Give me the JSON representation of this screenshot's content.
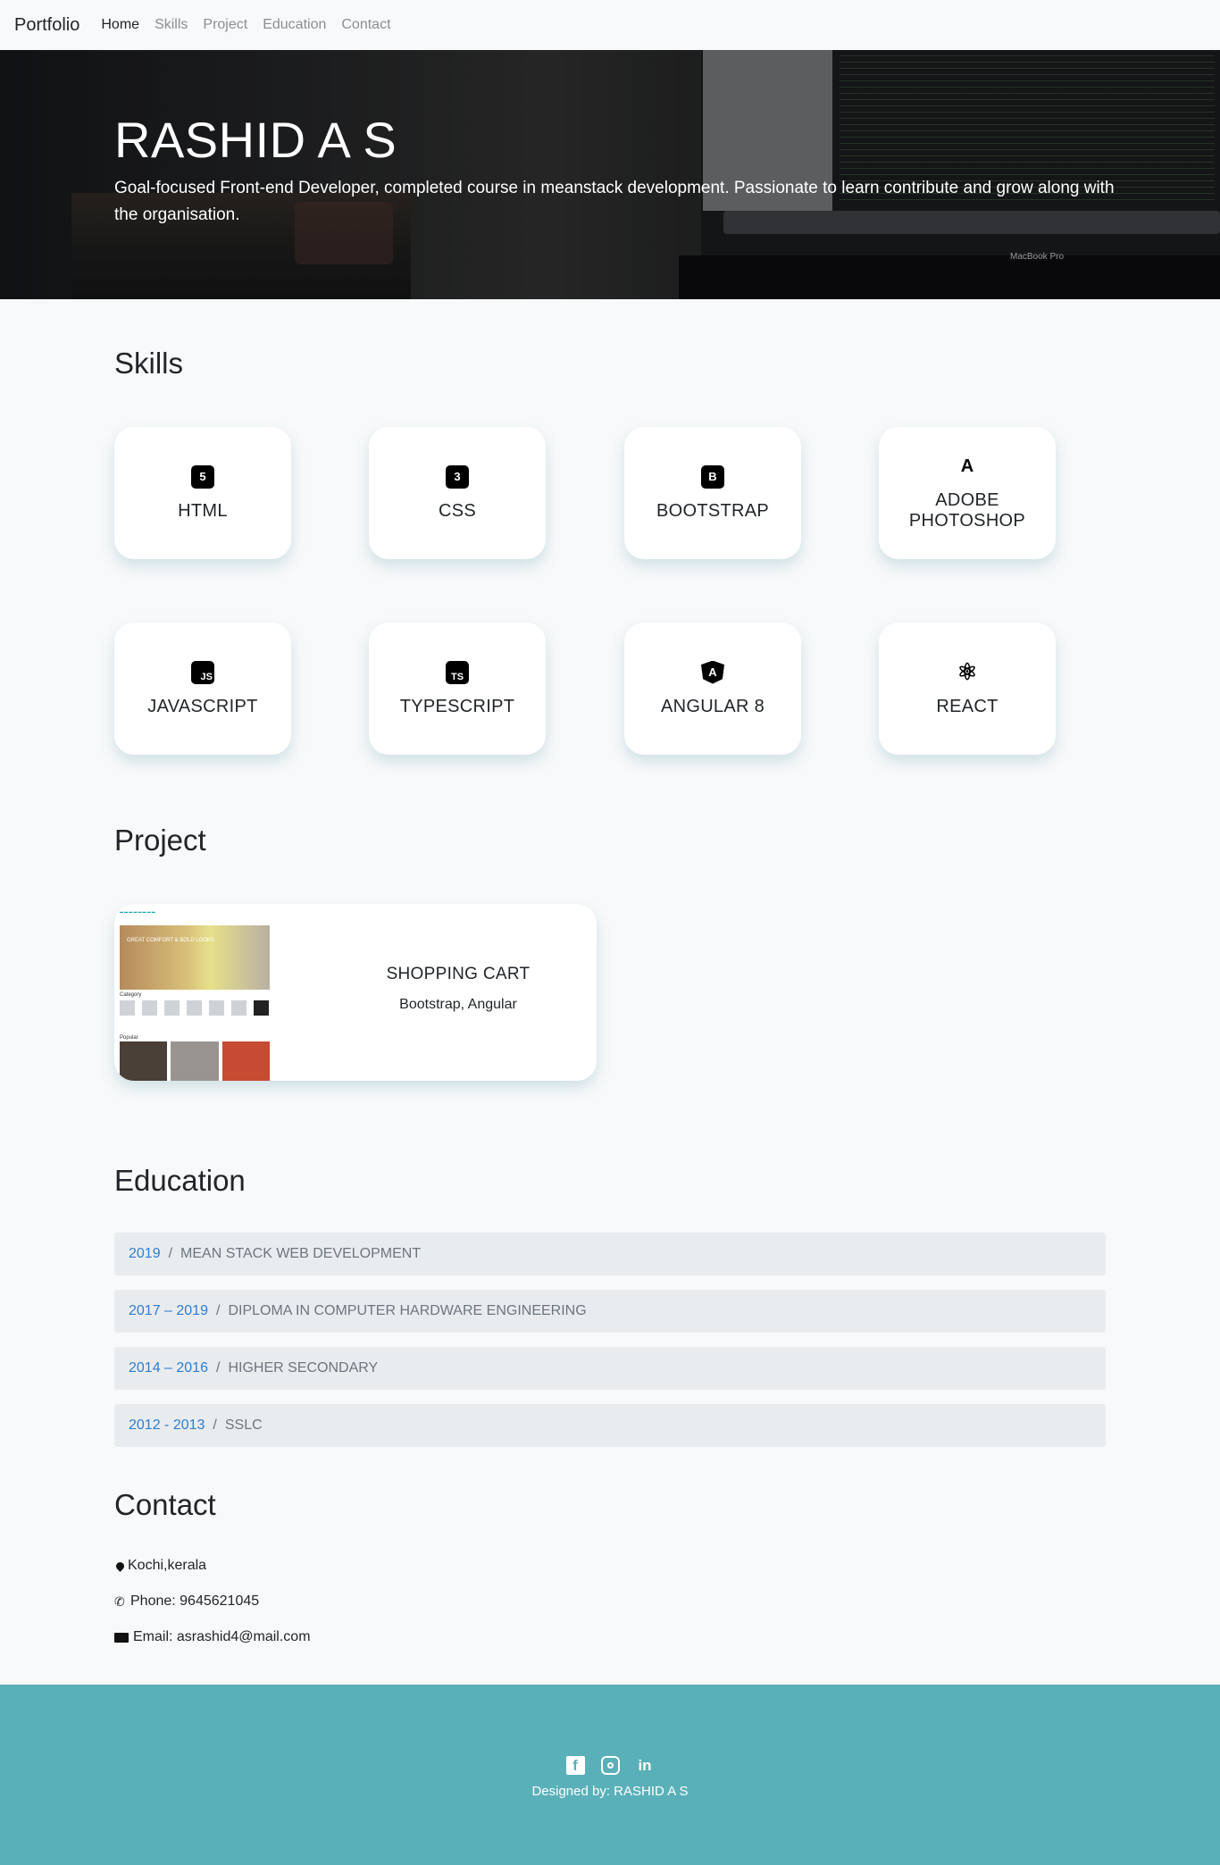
{
  "navbar": {
    "brand": "Portfolio",
    "links": [
      "Home",
      "Skills",
      "Project",
      "Education",
      "Contact"
    ]
  },
  "hero": {
    "name": "RASHID A S",
    "tagline": "Goal-focused Front-end Developer, completed course in meanstack development. Passionate to learn contribute and grow along with the organisation.",
    "laptop_label": "MacBook Pro"
  },
  "skills": {
    "title": "Skills",
    "items": [
      {
        "label": "HTML",
        "icon": "html5-icon",
        "glyph": "5"
      },
      {
        "label": "CSS",
        "icon": "css3-icon",
        "glyph": "3"
      },
      {
        "label": "BOOTSTRAP",
        "icon": "bootstrap-icon",
        "glyph": "B"
      },
      {
        "label": "ADOBE PHOTOSHOP",
        "icon": "adobe-icon",
        "glyph": "A"
      },
      {
        "label": "JAVASCRIPT",
        "icon": "javascript-icon",
        "glyph": "JS"
      },
      {
        "label": "TYPESCRIPT",
        "icon": "typescript-icon",
        "glyph": "TS"
      },
      {
        "label": "ANGULAR 8",
        "icon": "angular-icon",
        "glyph": "A"
      },
      {
        "label": "REACT",
        "icon": "react-icon",
        "glyph": "⚛"
      }
    ]
  },
  "project": {
    "title": "Project",
    "name": "SHOPPING CART",
    "tech": "Bootstrap, Angular",
    "thumbnail": {
      "headline": "GREAT COMFORT & BOLD LOOKS",
      "category_label": "Category",
      "popular_label": "Popular"
    }
  },
  "education": {
    "title": "Education",
    "items": [
      {
        "year": "2019",
        "name": "MEAN STACK WEB DEVELOPMENT"
      },
      {
        "year": "2017 – 2019",
        "name": "DIPLOMA IN COMPUTER HARDWARE ENGINEERING"
      },
      {
        "year": "2014 – 2016",
        "name": "HIGHER SECONDARY"
      },
      {
        "year": "2012 - 2013",
        "name": "SSLC"
      }
    ]
  },
  "contact": {
    "title": "Contact",
    "location": "Kochi,kerala",
    "phone": "Phone: 9645621045",
    "email": "Email: asrashid4@mail.com"
  },
  "footer": {
    "credit": "Designed by: RASHID A S",
    "social": [
      "facebook-icon",
      "instagram-icon",
      "linkedin-icon"
    ]
  },
  "colors": {
    "footer_bg": "#5ab0b8",
    "year_link": "#2d7dd2",
    "muted_text": "#6c757d",
    "edu_bg": "#e9ecef"
  }
}
